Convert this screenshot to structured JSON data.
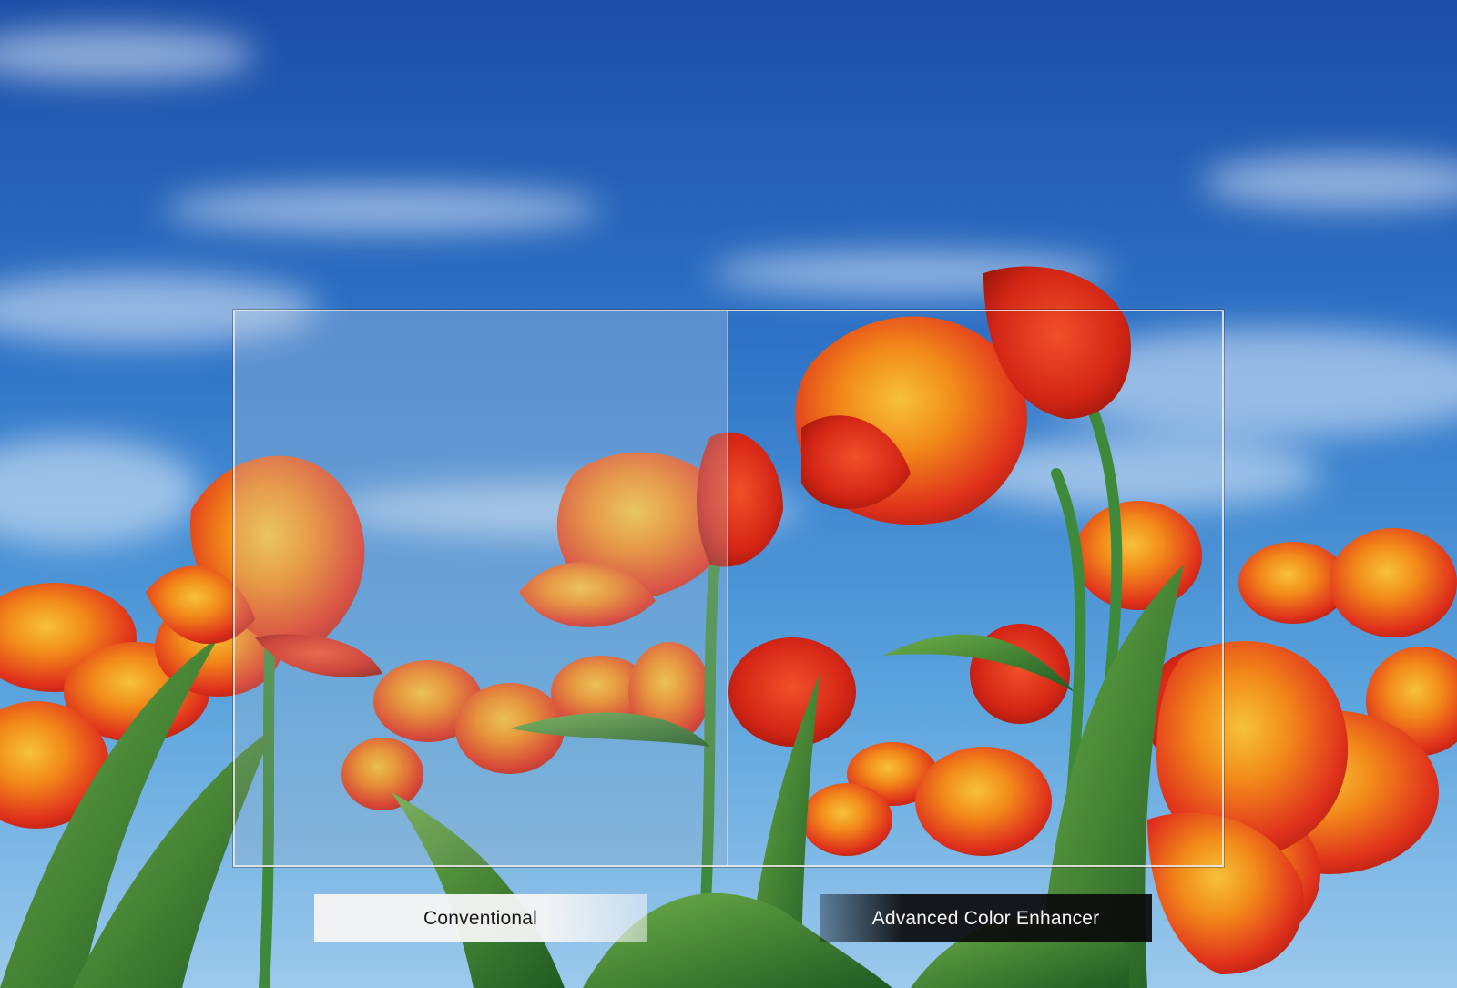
{
  "labels": {
    "conventional": "Conventional",
    "enhanced": "Advanced Color Enhancer"
  },
  "colors": {
    "sky_top": "#1a4fa8",
    "sky_bottom": "#6fb3e6",
    "petal_red": "#e0321c",
    "petal_orange": "#f28a1a",
    "petal_yellow": "#f6c23a",
    "stem_green": "#3e8a3a"
  }
}
